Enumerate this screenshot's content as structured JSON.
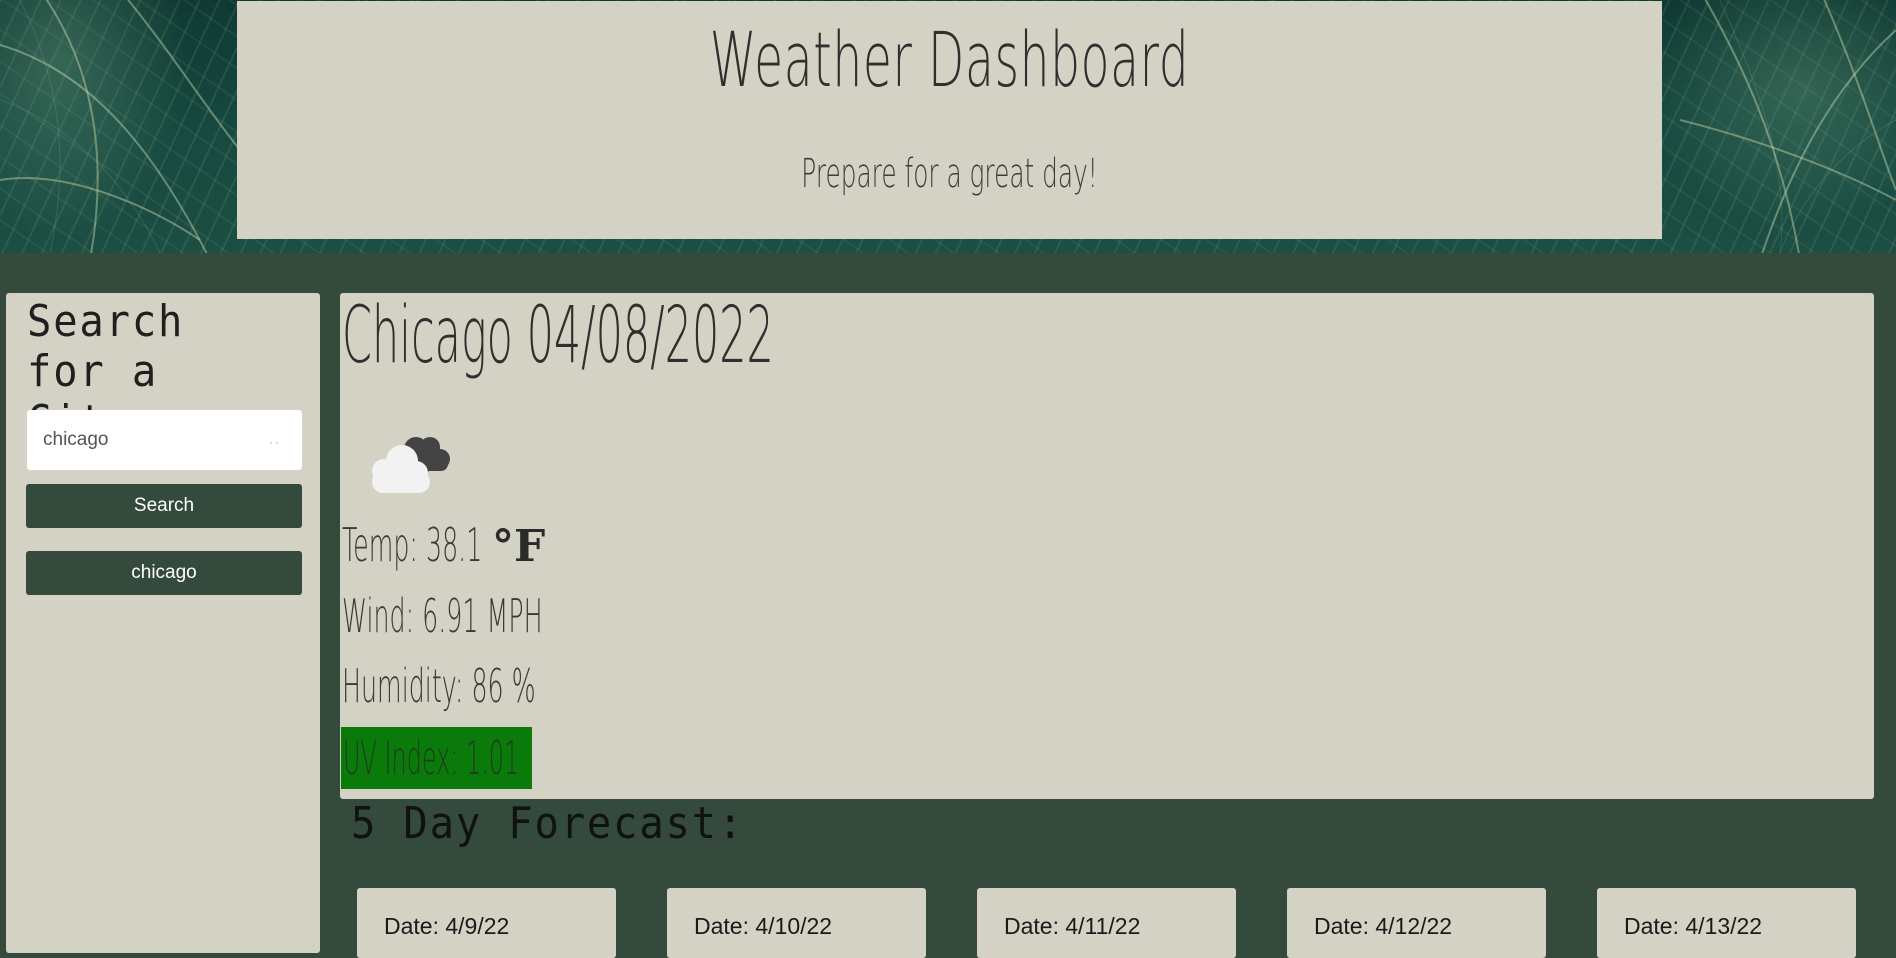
{
  "header": {
    "title": "Weather Dashboard",
    "subtitle": "Prepare for a great day!"
  },
  "sidebar": {
    "heading": "Search for a City:",
    "search_input_value": "chicago",
    "search_button_label": "Search",
    "history": [
      "chicago"
    ]
  },
  "current": {
    "city_date": "Chicago 04/08/2022",
    "icon": "cloudy-icon",
    "temp_label": "Temp: 38.1",
    "temp_unit": "°F",
    "wind": "Wind: 6.91 MPH",
    "humidity": "Humidity: 86 %",
    "uv": "UV Index: 1.01",
    "uv_color": "#0a7a0a"
  },
  "forecast": {
    "heading": "5 Day Forecast:",
    "days": [
      {
        "date": "Date: 4/9/22"
      },
      {
        "date": "Date: 4/10/22"
      },
      {
        "date": "Date: 4/11/22"
      },
      {
        "date": "Date: 4/12/22"
      },
      {
        "date": "Date: 4/13/22"
      }
    ]
  },
  "colors": {
    "background": "#344a3d",
    "card": "#d4d2c4",
    "button": "#344a3d"
  }
}
